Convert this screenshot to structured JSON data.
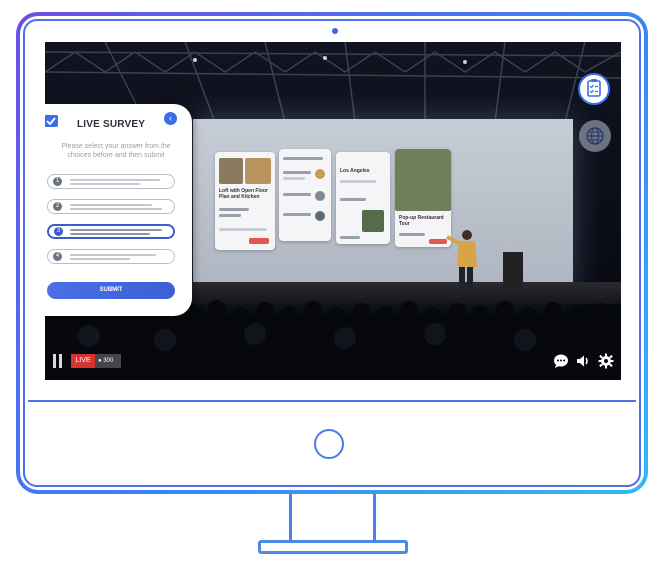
{
  "survey": {
    "title": "LIVE SURVEY",
    "instructions": "Please select your answer from the choices before and then submit",
    "choices": [
      "1",
      "2",
      "3",
      "4"
    ],
    "selected_choice": "3",
    "submit_label": "SUBMIT"
  },
  "stream": {
    "live_label": "LIVE",
    "viewer_count": "300"
  },
  "slides": {
    "card1_title": "Loft with Open Floor Plan and Kitchen",
    "card3_title": "Los Angeles",
    "card4_title": "Pop-up Restaurant Tour"
  },
  "colors": {
    "accent": "#3b6ee6",
    "live_red": "#d6342f",
    "frame_gradient": [
      "#6d4fe6",
      "#3b82f6",
      "#36b8f5"
    ]
  },
  "icons": {
    "survey_toggle": "clipboard-checklist-icon",
    "language": "globe-icon",
    "chat": "chat-bubble-icon",
    "volume": "speaker-icon",
    "settings": "gear-icon",
    "pause": "pause-icon",
    "viewers": "person-icon"
  }
}
